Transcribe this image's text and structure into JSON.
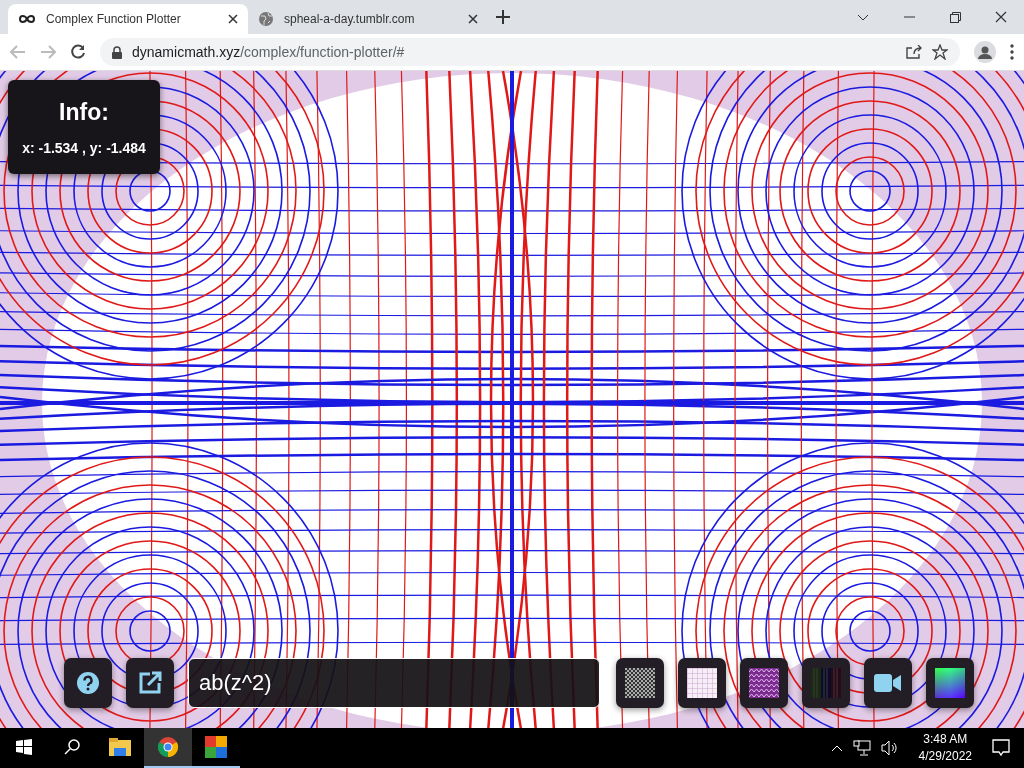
{
  "browser": {
    "tabs": [
      {
        "title": "Complex Function Plotter",
        "selected": true,
        "kind": "infinity"
      },
      {
        "title": "spheal-a-day.tumblr.com",
        "selected": false,
        "kind": "globe"
      }
    ],
    "url_host": "dynamicmath.xyz",
    "url_path": "/complex/function-plotter/#"
  },
  "info": {
    "title": "Info:",
    "coords": "x: -1.534 , y: -1.484"
  },
  "function_input": {
    "value": "ab(z^2)"
  },
  "swatches": [
    {
      "kind": "checker"
    },
    {
      "kind": "grid"
    },
    {
      "kind": "pattern"
    },
    {
      "kind": "bars"
    },
    {
      "kind": "video"
    },
    {
      "kind": "colorwheel"
    }
  ],
  "taskbar": {
    "apps": [
      {
        "kind": "files",
        "running": false,
        "selected": false
      },
      {
        "kind": "browser",
        "running": true,
        "selected": true
      },
      {
        "kind": "antivirus",
        "running": true,
        "selected": false
      }
    ],
    "time": "3:48 AM",
    "date": "4/29/2022"
  }
}
